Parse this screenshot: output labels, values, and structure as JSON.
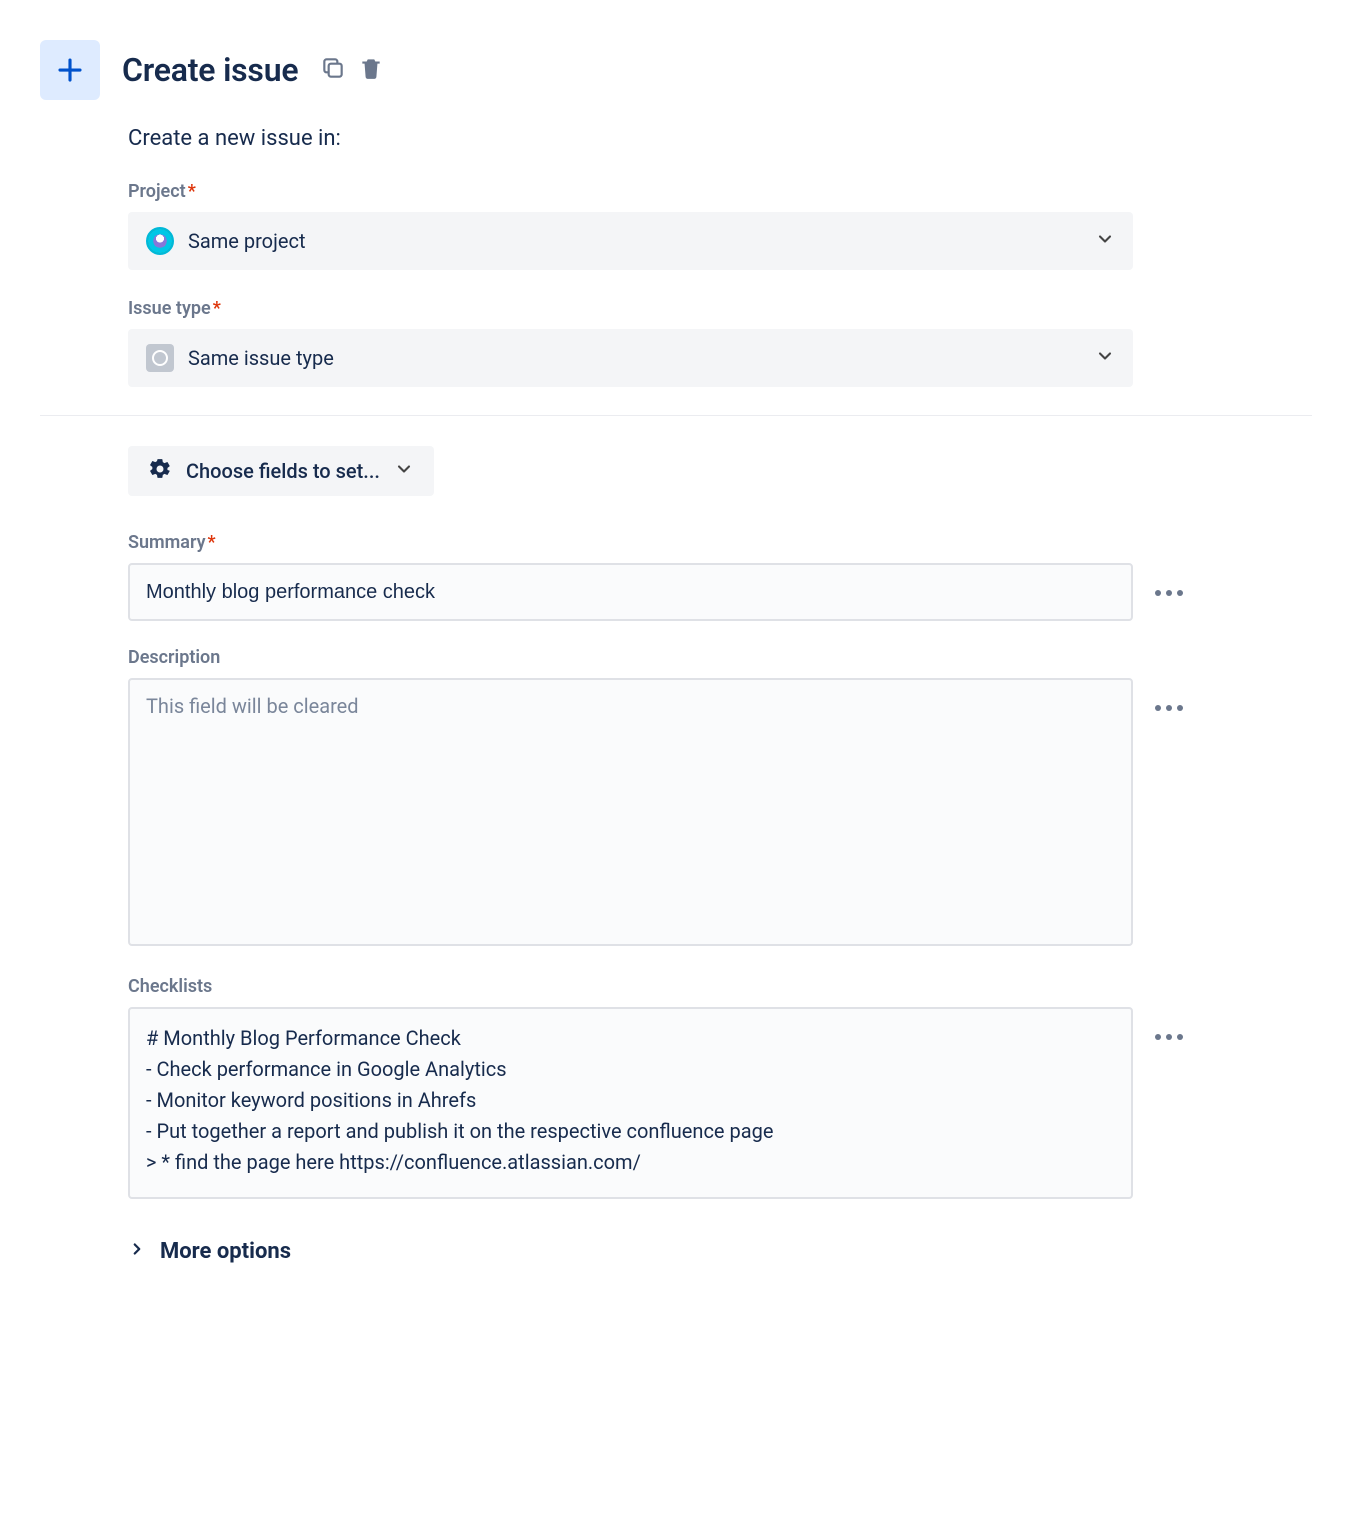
{
  "header": {
    "title": "Create issue"
  },
  "subtitle": "Create a new issue in:",
  "project": {
    "label": "Project",
    "value": "Same project"
  },
  "issueType": {
    "label": "Issue type",
    "value": "Same issue type"
  },
  "chooseFields": "Choose fields to set...",
  "summary": {
    "label": "Summary",
    "value": "Monthly blog performance check"
  },
  "description": {
    "label": "Description",
    "placeholder": "This field will be cleared"
  },
  "checklists": {
    "label": "Checklists",
    "value": "# Monthly Blog Performance Check\n- Check performance in Google Analytics\n- Monitor keyword positions in Ahrefs\n- Put together a report and publish it on the respective confluence page\n> * find the page here https://confluence.atlassian.com/"
  },
  "moreOptions": "More options",
  "requiredMark": "*"
}
